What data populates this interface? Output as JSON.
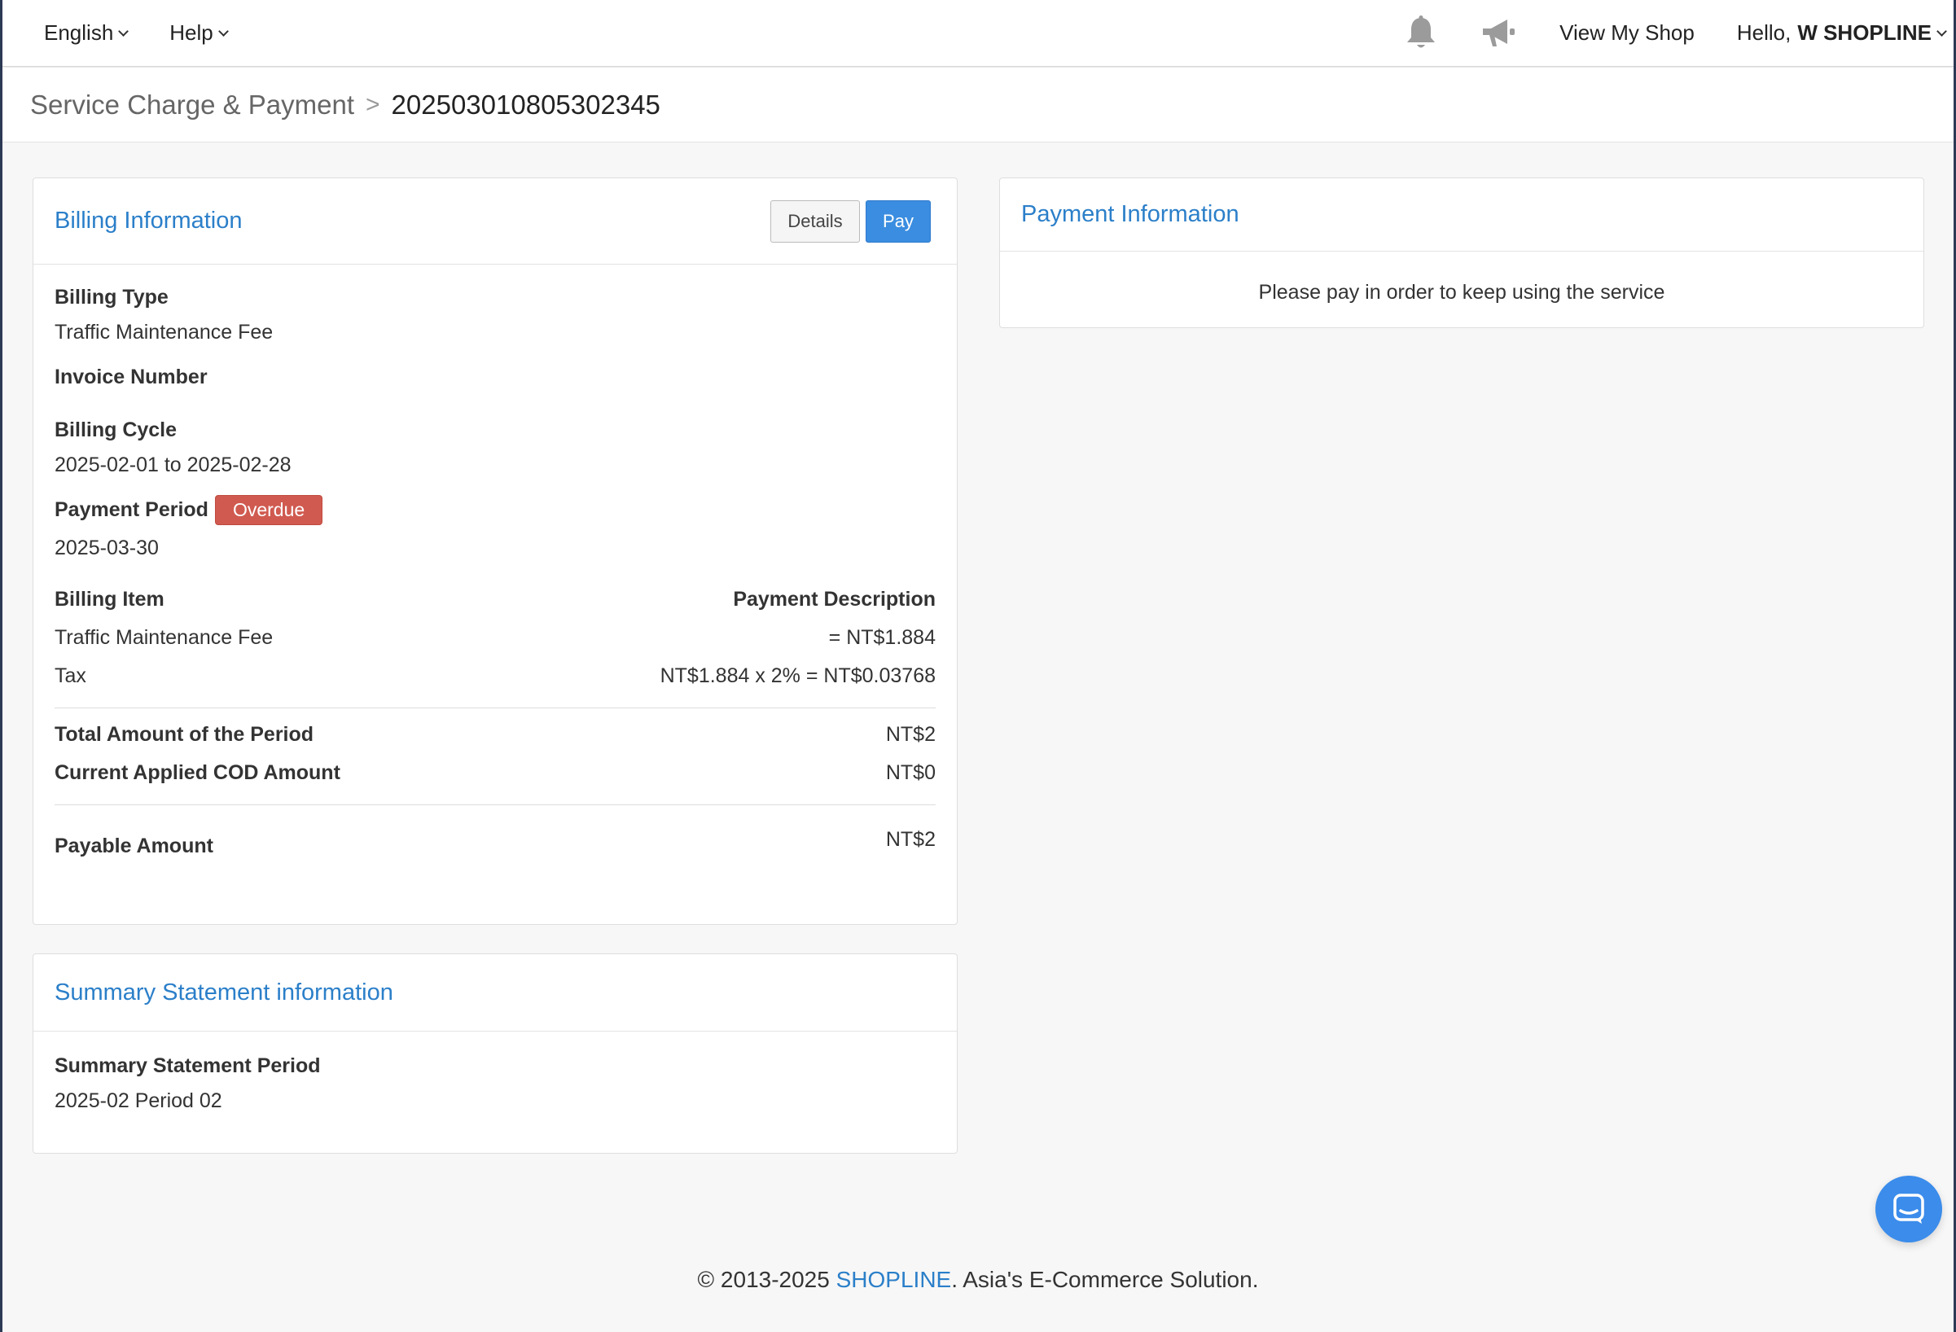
{
  "topbar": {
    "language": "English",
    "help": "Help",
    "bell_icon": "bell-icon",
    "announce_icon": "megaphone-icon",
    "view_shop": "View My Shop",
    "hello_prefix": "Hello,",
    "user_name": "W SHOPLINE"
  },
  "breadcrumb": {
    "parent": "Service Charge & Payment",
    "separator": ">",
    "current": "202503010805302345"
  },
  "billing": {
    "title": "Billing Information",
    "details_button": "Details",
    "pay_button": "Pay",
    "billing_type_label": "Billing Type",
    "billing_type_value": "Traffic Maintenance Fee",
    "invoice_number_label": "Invoice Number",
    "billing_cycle_label": "Billing Cycle",
    "billing_cycle_value": "2025-02-01 to 2025-02-28",
    "payment_period_label": "Payment Period",
    "status_badge": "Overdue",
    "payment_period_value": "2025-03-30",
    "items_header_left": "Billing Item",
    "items_header_right": "Payment Description",
    "items": [
      {
        "name": "Traffic Maintenance Fee",
        "description": "= NT$1.884"
      },
      {
        "name": "Tax",
        "description": "NT$1.884 x 2% = NT$0.03768"
      }
    ],
    "total_label": "Total Amount of the Period",
    "total_value": "NT$2",
    "cod_label": "Current Applied COD Amount",
    "cod_value": "NT$0",
    "payable_label": "Payable Amount",
    "payable_value": "NT$2"
  },
  "payment_info": {
    "title": "Payment Information",
    "message": "Please pay in order to keep using the service"
  },
  "summary": {
    "title": "Summary Statement information",
    "period_label": "Summary Statement Period",
    "period_value": "2025-02 Period 02"
  },
  "footer": {
    "copyright": "© 2013-2025",
    "brand": "SHOPLINE",
    "tagline": ". Asia's E-Commerce Solution."
  },
  "colors": {
    "accent": "#2b7fc9",
    "primary_button": "#3a8de0",
    "overdue_badge": "#d05a50",
    "chat_button": "#3b8ceb"
  },
  "chat_icon": "chat-bubble-icon"
}
